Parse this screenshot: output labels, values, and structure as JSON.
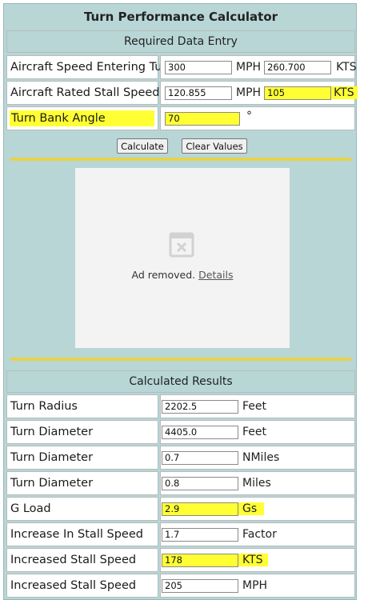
{
  "title": "Turn Performance Calculator",
  "entry": {
    "heading": "Required Data Entry",
    "speed": {
      "label": "Aircraft Speed Entering Turn",
      "mph": "300",
      "mph_unit": "MPH",
      "kts": "260.700",
      "kts_unit": "KTS"
    },
    "stall": {
      "label": "Aircraft Rated Stall Speed",
      "mph": "120.855",
      "mph_unit": "MPH",
      "kts": "105",
      "kts_unit": "KTS"
    },
    "bank": {
      "label": "Turn Bank Angle",
      "value": "70",
      "unit": "°"
    }
  },
  "buttons": {
    "calculate": "Calculate",
    "clear": "Clear Values"
  },
  "ad": {
    "text": "Ad removed.",
    "link": "Details"
  },
  "results": {
    "heading": "Calculated Results",
    "rows": [
      {
        "label": "Turn Radius",
        "value": "2202.5",
        "unit": "Feet"
      },
      {
        "label": "Turn Diameter",
        "value": "4405.0",
        "unit": "Feet"
      },
      {
        "label": "Turn Diameter",
        "value": "0.7",
        "unit": "NMiles"
      },
      {
        "label": "Turn Diameter",
        "value": "0.8",
        "unit": "Miles"
      },
      {
        "label": "G Load",
        "value": "2.9",
        "unit": "Gs"
      },
      {
        "label": "Increase In Stall Speed",
        "value": "1.7",
        "unit": "Factor"
      },
      {
        "label": "Increased Stall Speed",
        "value": "178",
        "unit": "KTS"
      },
      {
        "label": "Increased Stall Speed",
        "value": "205",
        "unit": "MPH"
      }
    ]
  },
  "colors": {
    "panel": "#b8d6d6",
    "highlight": "#ffff33",
    "stripe": "#e8d24a",
    "border": "#b6bcbc"
  }
}
